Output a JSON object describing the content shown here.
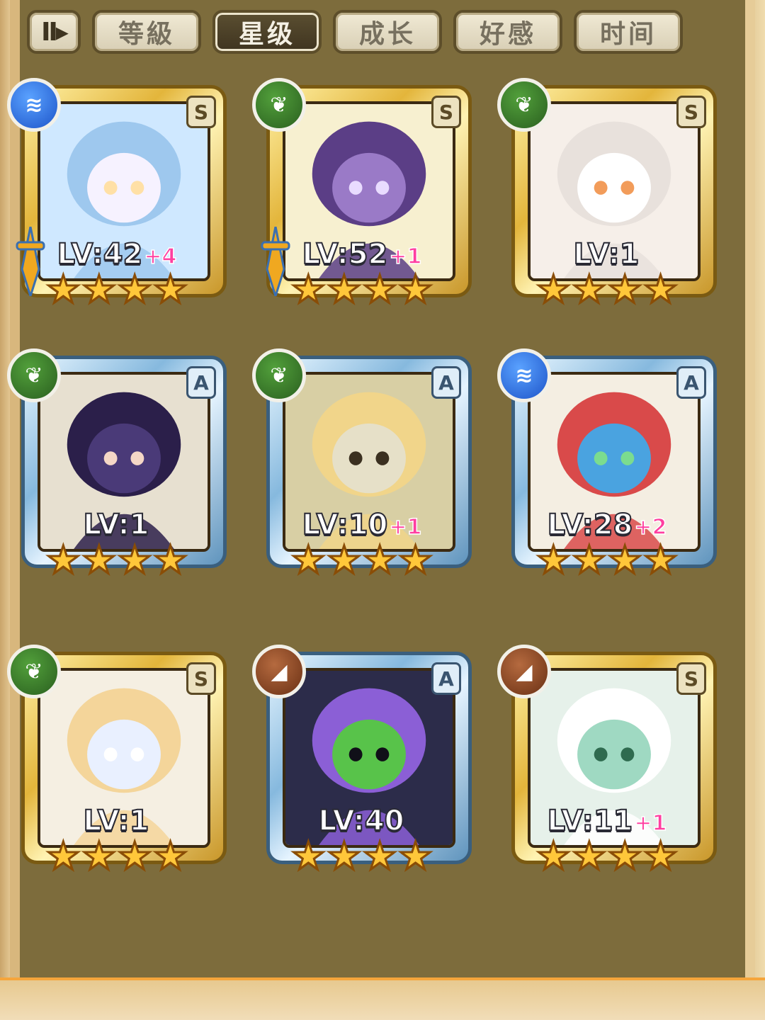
{
  "tabs": [
    {
      "label": "",
      "icon": "sort-order-icon",
      "active": false
    },
    {
      "label": "等級",
      "active": false
    },
    {
      "label": "星级",
      "active": true
    },
    {
      "label": "成长",
      "active": false
    },
    {
      "label": "好感",
      "active": false
    },
    {
      "label": "时间",
      "active": false
    }
  ],
  "cards": [
    {
      "rank": "S",
      "frame": "gold",
      "element": "water",
      "weapon": true,
      "level": "LV:42",
      "plus": "+4",
      "stars": 4
    },
    {
      "rank": "S",
      "frame": "gold",
      "element": "wood",
      "weapon": true,
      "level": "LV:52",
      "plus": "+1",
      "stars": 4
    },
    {
      "rank": "S",
      "frame": "gold",
      "element": "wood",
      "weapon": false,
      "level": "LV:1",
      "plus": "",
      "stars": 4
    },
    {
      "rank": "A",
      "frame": "blue",
      "element": "wood",
      "weapon": false,
      "level": "LV:1",
      "plus": "",
      "stars": 4
    },
    {
      "rank": "A",
      "frame": "blue",
      "element": "wood",
      "weapon": false,
      "level": "LV:10",
      "plus": "+1",
      "stars": 4
    },
    {
      "rank": "A",
      "frame": "blue",
      "element": "water",
      "weapon": false,
      "level": "LV:28",
      "plus": "+2",
      "stars": 4
    },
    {
      "rank": "S",
      "frame": "gold",
      "element": "wood",
      "weapon": false,
      "level": "LV:1",
      "plus": "",
      "stars": 4
    },
    {
      "rank": "A",
      "frame": "blue",
      "element": "earth",
      "weapon": false,
      "level": "LV:40",
      "plus": "",
      "stars": 4
    },
    {
      "rank": "S",
      "frame": "gold",
      "element": "earth",
      "weapon": false,
      "level": "LV:11",
      "plus": "+1",
      "stars": 4
    }
  ],
  "colors": {
    "panel": "#7d6c3c",
    "gold_frame": "#e3b53b",
    "blue_frame": "#86b9de",
    "level_plus": "#ff3fa0",
    "star": "#ffc73a"
  }
}
